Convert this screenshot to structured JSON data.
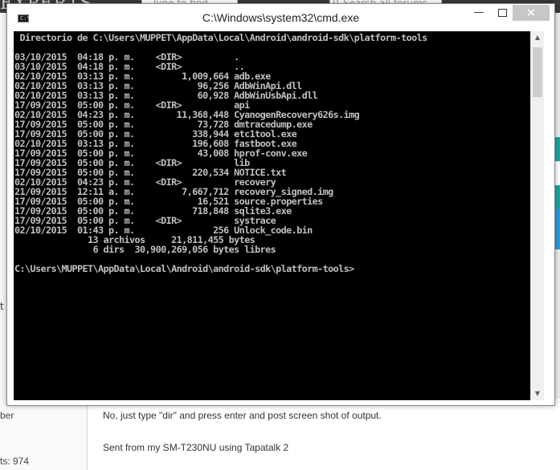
{
  "background": {
    "logo_text": "EXPERTS",
    "search_device_placeholder": "Type to find device...",
    "search_forums_placeholder": "Search all forums",
    "left_clipped_text": "t",
    "post": {
      "text": "No, just type \"dir\" and press enter and post screen shot of output.",
      "signature": "Sent from my SM-T230NU using Tapatalk 2"
    },
    "user": {
      "role": "ber",
      "posts": "ts: 974"
    }
  },
  "window": {
    "title": "C:\\Windows\\system32\\cmd.exe",
    "minimize_glyph": "—",
    "close_glyph": "✕",
    "scroll_up_glyph": "▲",
    "scroll_down_glyph": "▼"
  },
  "console": {
    "lines": [
      " Directorio de C:\\Users\\MUPPET\\AppData\\Local\\Android\\android-sdk\\platform-tools",
      "",
      "03/10/2015  04:18 p. m.    <DIR>          .",
      "03/10/2015  04:18 p. m.    <DIR>          ..",
      "02/10/2015  03:13 p. m.         1,009,664 adb.exe",
      "02/10/2015  03:13 p. m.            96,256 AdbWinApi.dll",
      "02/10/2015  03:13 p. m.            60,928 AdbWinUsbApi.dll",
      "17/09/2015  05:00 p. m.    <DIR>          api",
      "02/10/2015  04:23 p. m.        11,368,448 CyanogenRecovery626s.img",
      "17/09/2015  05:00 p. m.            73,728 dmtracedump.exe",
      "17/09/2015  05:00 p. m.           338,944 etc1tool.exe",
      "02/10/2015  03:13 p. m.           196,608 fastboot.exe",
      "17/09/2015  05:00 p. m.            43,008 hprof-conv.exe",
      "17/09/2015  05:00 p. m.    <DIR>          lib",
      "17/09/2015  05:00 p. m.           220,534 NOTICE.txt",
      "02/10/2015  04:23 p. m.    <DIR>          recovery",
      "21/09/2015  12:11 a. m.         7,667,712 recovery_signed.img",
      "17/09/2015  05:00 p. m.            16,521 source.properties",
      "17/09/2015  05:00 p. m.           718,848 sqlite3.exe",
      "17/09/2015  05:00 p. m.    <DIR>          systrace",
      "02/10/2015  01:43 p. m.               256 Unlock_code.bin",
      "              13 archivos     21,811,455 bytes",
      "               6 dirs  30,900,269,056 bytes libres",
      "",
      "C:\\Users\\MUPPET\\AppData\\Local\\Android\\android-sdk\\platform-tools>"
    ]
  }
}
